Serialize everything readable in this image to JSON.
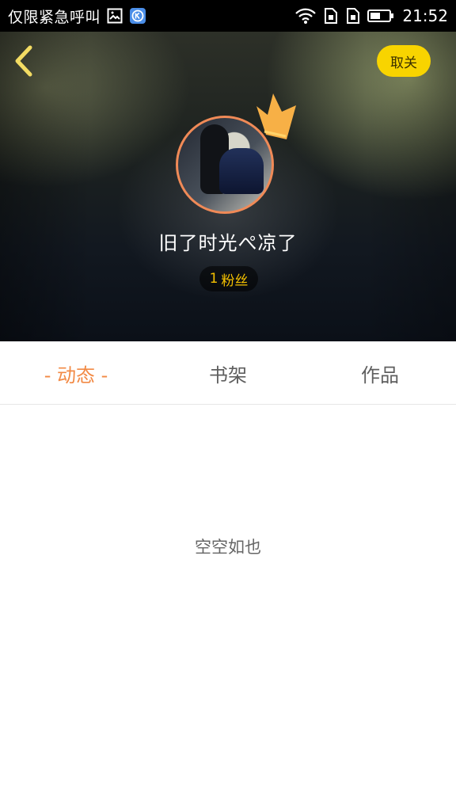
{
  "status_bar": {
    "carrier": "仅限紧急呼叫",
    "time": "21:52",
    "icons": [
      "gallery-icon",
      "k-app-icon",
      "wifi-icon",
      "sim-card-icon",
      "sim-card-icon",
      "battery-icon"
    ]
  },
  "header": {
    "unfollow_label": "取关",
    "username": "旧了时光ぺ凉了",
    "fans_count": "1",
    "fans_label": "粉丝",
    "colors": {
      "button": "#f8d400",
      "fans": "#f4c000",
      "avatar_border": "#f08a57",
      "crown": "#f7b046"
    }
  },
  "tabs": [
    {
      "label": "- 动态 -",
      "active": true
    },
    {
      "label": "书架",
      "active": false
    },
    {
      "label": "作品",
      "active": false
    }
  ],
  "content": {
    "empty_text": "空空如也"
  }
}
